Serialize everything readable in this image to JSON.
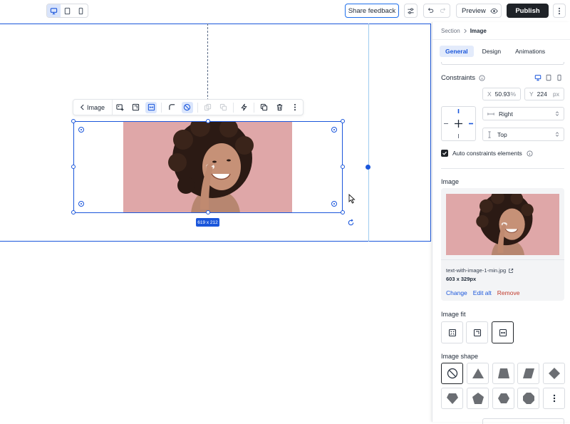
{
  "topbar": {
    "share_feedback": "Share feedback",
    "preview": "Preview",
    "publish": "Publish"
  },
  "canvas": {
    "size_badge": "619 x 212",
    "toolbar_back_label": "Image"
  },
  "panel": {
    "breadcrumb": {
      "parent": "Section",
      "current": "Image"
    },
    "tabs": [
      {
        "label": "General",
        "active": true
      },
      {
        "label": "Design",
        "active": false
      },
      {
        "label": "Animations",
        "active": false
      }
    ],
    "constraints": {
      "title": "Constraints",
      "x_label": "X",
      "x_value": "50.93",
      "x_unit": "%",
      "y_label": "Y",
      "y_value": "224",
      "y_unit": "px",
      "horizontal": "Right",
      "vertical": "Top",
      "auto_label": "Auto constraints elements"
    },
    "image": {
      "title": "Image",
      "filename": "text-with-image-1-min.jpg",
      "dimensions": "603 x 329px",
      "change": "Change",
      "edit_alt": "Edit alt",
      "remove": "Remove"
    },
    "image_fit": {
      "title": "Image fit"
    },
    "image_shape": {
      "title": "Image shape"
    }
  },
  "colors": {
    "accent": "#1a56db",
    "photo_bg": "#dfa7a8",
    "publish_bg": "#1f2328",
    "remove": "#c0392b"
  }
}
